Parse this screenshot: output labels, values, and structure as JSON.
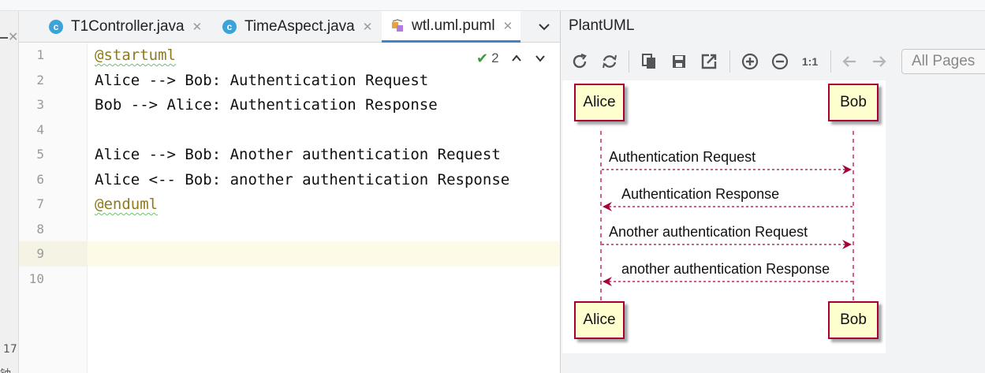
{
  "left_sliver": {
    "line_number": "17",
    "cjk_text": "钟"
  },
  "editor_tabs": [
    {
      "label": "T1Controller.java",
      "icon": "java-class-icon",
      "icon_glyph": "c",
      "active": false
    },
    {
      "label": "TimeAspect.java",
      "icon": "java-class-icon",
      "icon_glyph": "c",
      "active": false
    },
    {
      "label": "wtl.uml.puml",
      "icon": "plantuml-file-icon",
      "active": true
    }
  ],
  "editor": {
    "inspection_count": "2",
    "lines": [
      {
        "number": "1",
        "text": "@startuml",
        "kind": "keyword"
      },
      {
        "number": "2",
        "text": "Alice --> Bob: Authentication Request",
        "kind": "code"
      },
      {
        "number": "3",
        "text": "Bob --> Alice: Authentication Response",
        "kind": "code"
      },
      {
        "number": "4",
        "text": "",
        "kind": "code"
      },
      {
        "number": "5",
        "text": "Alice --> Bob: Another authentication Request",
        "kind": "code"
      },
      {
        "number": "6",
        "text": "Alice <-- Bob: another authentication Response",
        "kind": "code"
      },
      {
        "number": "7",
        "text": "@enduml",
        "kind": "keyword"
      },
      {
        "number": "8",
        "text": "",
        "kind": "code"
      },
      {
        "number": "9",
        "text": "",
        "kind": "code",
        "current": true
      },
      {
        "number": "10",
        "text": "",
        "kind": "code"
      }
    ]
  },
  "plantuml_panel": {
    "title": "PlantUML",
    "page_select": "All Pages",
    "toolbar": [
      "refresh-icon",
      "sync-icon",
      "copy-icon",
      "save-icon",
      "open-external-icon",
      "zoom-in-icon",
      "zoom-out-icon",
      "actual-size-icon",
      "back-icon",
      "forward-icon"
    ],
    "actual_size_label": "1:1",
    "diagram": {
      "participants": [
        "Alice",
        "Bob"
      ],
      "messages": [
        {
          "text": "Authentication Request",
          "from": "Alice",
          "to": "Bob"
        },
        {
          "text": "Authentication Response",
          "from": "Bob",
          "to": "Alice"
        },
        {
          "text": "Another authentication Request",
          "from": "Alice",
          "to": "Bob"
        },
        {
          "text": "another authentication Response",
          "from": "Bob",
          "to": "Alice"
        }
      ],
      "colors": {
        "participant_fill": "#fefece",
        "participant_border": "#a80036",
        "arrow": "#a80036"
      }
    }
  }
}
